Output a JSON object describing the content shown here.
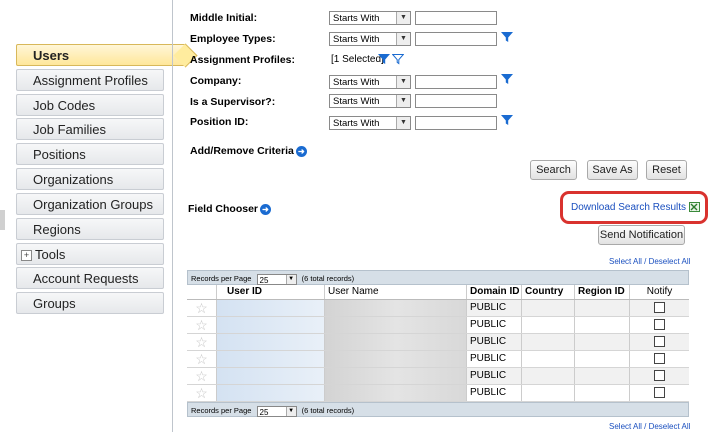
{
  "sidebar": {
    "items": [
      {
        "label": "Users",
        "active": true
      },
      {
        "label": "Assignment Profiles"
      },
      {
        "label": "Job Codes"
      },
      {
        "label": "Job Families"
      },
      {
        "label": "Positions"
      },
      {
        "label": "Organizations"
      },
      {
        "label": "Organization Groups"
      },
      {
        "label": "Regions"
      },
      {
        "label": "Tools",
        "expandable": true
      },
      {
        "label": "Account Requests"
      },
      {
        "label": "Groups"
      }
    ],
    "expand_glyph": "+"
  },
  "criteria": [
    {
      "label": "Middle Initial:",
      "operator": "Starts With",
      "has_input": true,
      "filter": false
    },
    {
      "label": "Employee Types:",
      "operator": "Starts With",
      "has_input": true,
      "filter": true
    },
    {
      "label": "Assignment Profiles:",
      "value": "[1 Selected]",
      "filter_icons": 2
    },
    {
      "label": "Company:",
      "operator": "Starts With",
      "has_input": true,
      "filter": true
    },
    {
      "label": "Is a Supervisor?:",
      "operator": "Starts With",
      "has_input": true,
      "filter": false
    },
    {
      "label": "Position ID:",
      "operator": "Starts With",
      "has_input": true,
      "filter": true
    }
  ],
  "add_remove_criteria": "Add/Remove Criteria",
  "buttons": {
    "search": "Search",
    "save_as": "Save As",
    "reset": "Reset",
    "send_notification": "Send Notification"
  },
  "field_chooser": "Field Chooser",
  "download_link": "Download Search Results",
  "select_all": "Select All / Deselect All",
  "pager": {
    "label": "Records per Page",
    "value": "25",
    "total": "(6 total records)"
  },
  "table": {
    "columns": [
      "",
      "User ID",
      "User Name",
      "Domain ID",
      "Country",
      "Region ID",
      "Notify"
    ],
    "rows": [
      {
        "domain_id": "PUBLIC"
      },
      {
        "domain_id": "PUBLIC"
      },
      {
        "domain_id": "PUBLIC"
      },
      {
        "domain_id": "PUBLIC"
      },
      {
        "domain_id": "PUBLIC"
      },
      {
        "domain_id": "PUBLIC"
      }
    ]
  },
  "colors": {
    "accent_link": "#1a4fbf",
    "highlight": "#d9322e",
    "active_nav": "#ffe79a"
  },
  "icons": {
    "filter": "funnel-icon",
    "go": "arrow-circle-icon",
    "excel": "excel-icon",
    "favorite": "star-icon"
  }
}
